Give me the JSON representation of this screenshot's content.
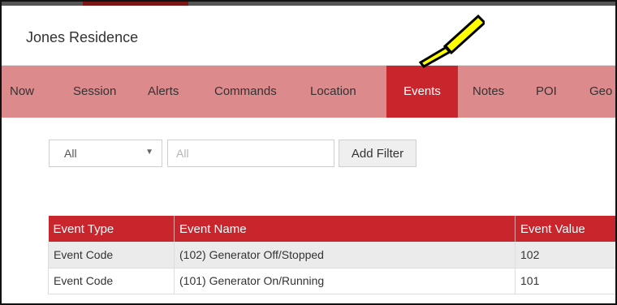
{
  "window": {
    "title": "Jones Residence"
  },
  "nav": {
    "items": [
      "Now",
      "Session",
      "Alerts",
      "Commands",
      "Location",
      "Events",
      "Notes",
      "POI",
      "Geo"
    ],
    "active": "Events",
    "colors": {
      "bar": "#dc8a8c",
      "active": "#c9252c"
    }
  },
  "filters": {
    "select_value": "All",
    "input_placeholder": "All",
    "add_filter_label": "Add Filter"
  },
  "table": {
    "columns": [
      "Event Type",
      "Event Name",
      "Event Value"
    ],
    "rows": [
      [
        "Event Code",
        "(102) Generator Off/Stopped",
        "102"
      ],
      [
        "Event Code",
        "(101) Generator On/Running",
        "101"
      ]
    ]
  },
  "annotation": {
    "icon": "pointer-arrow-icon",
    "color": "#ffff00"
  }
}
